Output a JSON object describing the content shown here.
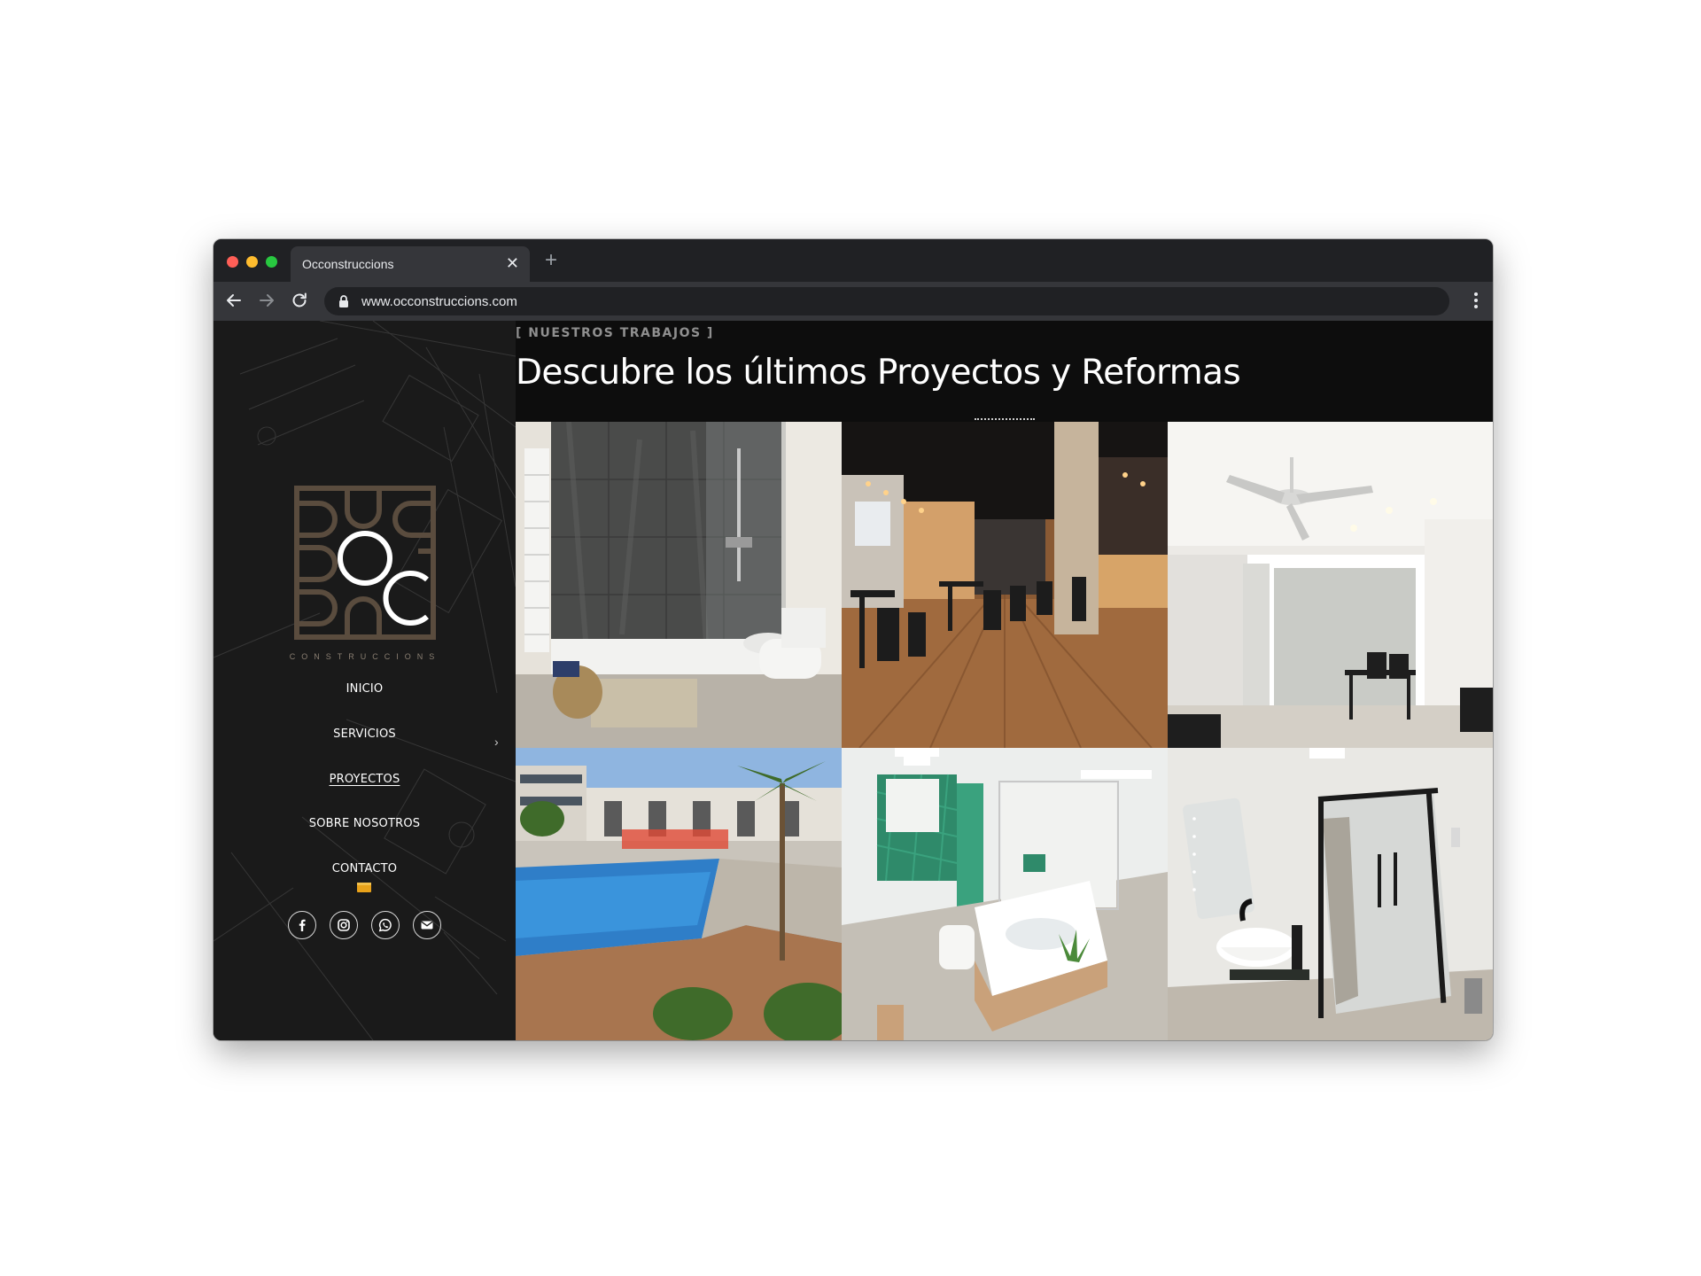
{
  "browser": {
    "tab_title": "Occonstruccions",
    "close_symbol": "✕",
    "new_tab_symbol": "+",
    "url": "www.occonstruccions.com"
  },
  "sidebar": {
    "logo_text": "CONSTRUCCIONS",
    "menu": [
      {
        "label": "INICIO"
      },
      {
        "label": "SERVICIOS"
      },
      {
        "label": "PROYECTOS"
      },
      {
        "label": "SOBRE NOSOTROS"
      },
      {
        "label": "CONTACTO"
      }
    ],
    "submenu_chevron": "›",
    "social_icons": [
      "facebook-icon",
      "instagram-icon",
      "whatsapp-icon",
      "email-icon"
    ]
  },
  "main": {
    "eyebrow": "[ NUESTROS TRABAJOS ]",
    "headline": "Descubre los últimos Proyectos y Reformas",
    "projects": [
      {
        "name": "bathroom-shower-gray-tiles"
      },
      {
        "name": "restaurant-interior"
      },
      {
        "name": "living-room-ceiling-fan"
      },
      {
        "name": "residential-pool"
      },
      {
        "name": "bathroom-green-tiles"
      },
      {
        "name": "bathroom-black-shower-screen"
      }
    ]
  },
  "colors": {
    "sidebar_bg": "#1a1a1a",
    "main_bg": "#0d0d0d",
    "logo_brown": "#5a4c3e",
    "flag": "#e8a21a"
  }
}
